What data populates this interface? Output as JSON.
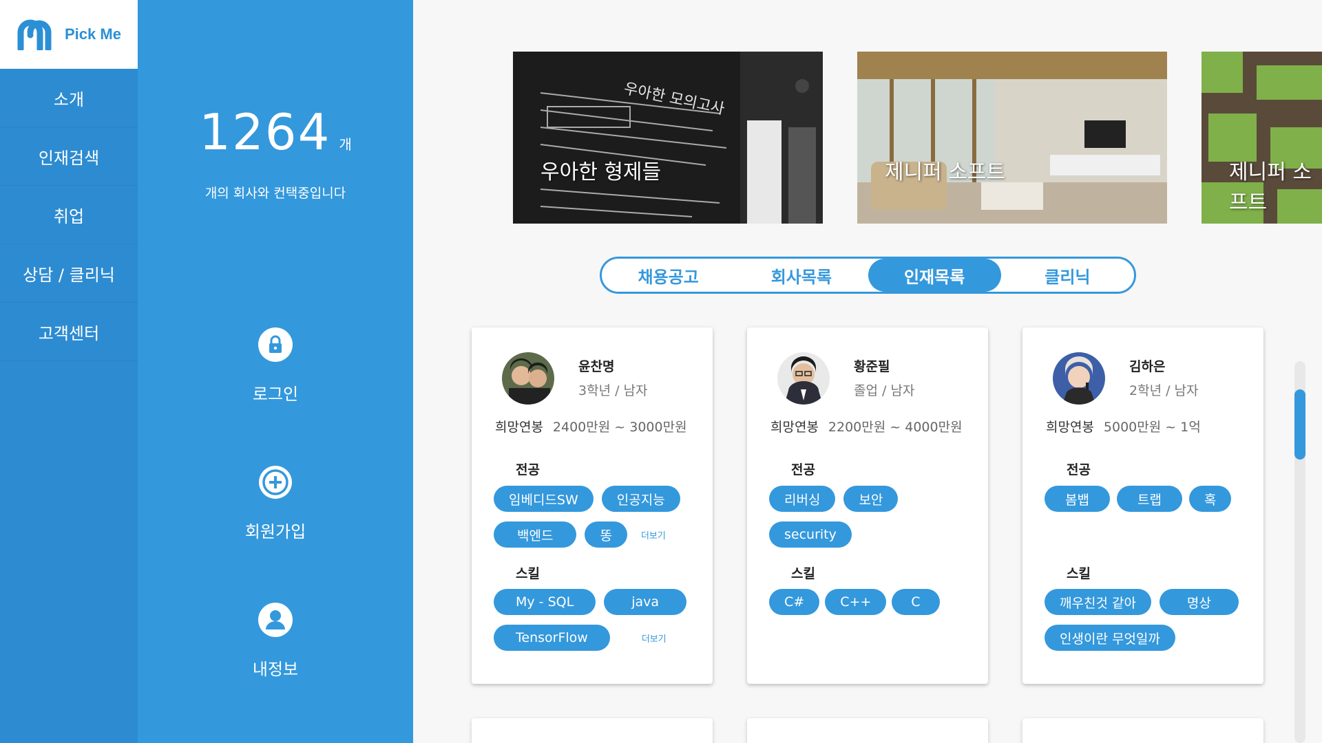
{
  "brand": {
    "name": "Pick Me",
    "color": "#2b8fd6"
  },
  "nav": {
    "items": [
      {
        "label": "소개"
      },
      {
        "label": "인재검색"
      },
      {
        "label": "취업"
      },
      {
        "label": "상담 / 클리닉"
      },
      {
        "label": "고객센터"
      }
    ]
  },
  "stats": {
    "count": "1264",
    "unit": "개",
    "description": "개의 회사와 컨택중입니다"
  },
  "panel_actions": [
    {
      "label": "로그인",
      "icon": "lock-icon"
    },
    {
      "label": "회원가입",
      "icon": "plus-circle-icon"
    },
    {
      "label": "내정보",
      "icon": "user-icon"
    }
  ],
  "banners": [
    {
      "title": "우아한 형제들"
    },
    {
      "title": "제니퍼 소프트"
    },
    {
      "title": "제니퍼 소프트"
    }
  ],
  "tabs": [
    {
      "label": "채용공고",
      "active": false
    },
    {
      "label": "회사목록",
      "active": false
    },
    {
      "label": "인재목록",
      "active": true
    },
    {
      "label": "클리닉",
      "active": false
    }
  ],
  "labels": {
    "salary": "희망연봉",
    "major": "전공",
    "skill": "스킬",
    "more": "더보기"
  },
  "cards": [
    {
      "name": "윤찬명",
      "info": "3학년 / 남자",
      "salary": "2400만원 ~ 3000만원",
      "majors": [
        "임베디드SW",
        "인공지능",
        "백엔드",
        "똥"
      ],
      "majors_more": true,
      "skills": [
        "My - SQL",
        "java",
        "TensorFlow"
      ],
      "skills_more": true
    },
    {
      "name": "황준필",
      "info": "졸업 / 남자",
      "salary": "2200만원 ~ 4000만원",
      "majors": [
        "리버싱",
        "보안",
        "security"
      ],
      "majors_more": false,
      "skills": [
        "C#",
        "C++",
        "C"
      ],
      "skills_more": false
    },
    {
      "name": "김하은",
      "info": "2학년 / 남자",
      "salary": "5000만원 ~ 1억",
      "majors": [
        "봄뱁",
        "트랩",
        "혹"
      ],
      "majors_more": false,
      "skills": [
        "깨우친것 같아",
        "명상",
        "인생이란 무엇일까"
      ],
      "skills_more": false
    }
  ],
  "colors": {
    "accent": "#3498dc",
    "nav": "#2d8bd1"
  }
}
